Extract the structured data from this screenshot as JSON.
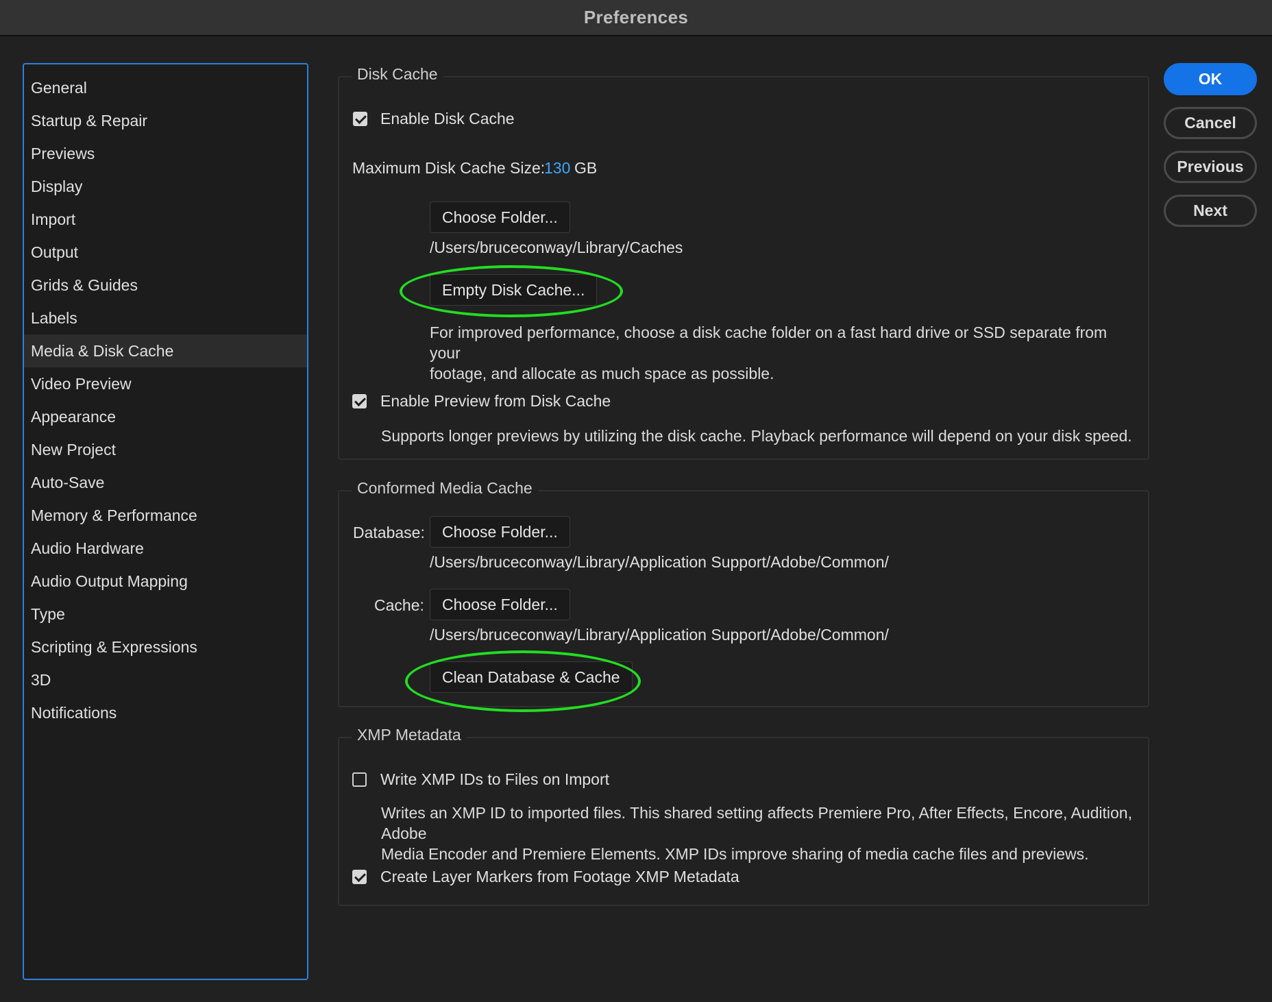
{
  "window": {
    "title": "Preferences"
  },
  "sidebar": {
    "items": [
      {
        "label": "General"
      },
      {
        "label": "Startup & Repair"
      },
      {
        "label": "Previews"
      },
      {
        "label": "Display"
      },
      {
        "label": "Import"
      },
      {
        "label": "Output"
      },
      {
        "label": "Grids & Guides"
      },
      {
        "label": "Labels"
      },
      {
        "label": "Media & Disk Cache",
        "selected": true
      },
      {
        "label": "Video Preview"
      },
      {
        "label": "Appearance"
      },
      {
        "label": "New Project"
      },
      {
        "label": "Auto-Save"
      },
      {
        "label": "Memory & Performance"
      },
      {
        "label": "Audio Hardware"
      },
      {
        "label": "Audio Output Mapping"
      },
      {
        "label": "Type"
      },
      {
        "label": "Scripting & Expressions"
      },
      {
        "label": "3D"
      },
      {
        "label": "Notifications"
      }
    ]
  },
  "disk_cache": {
    "legend": "Disk Cache",
    "enable_label": "Enable Disk Cache",
    "enable_checked": true,
    "max_size_label": "Maximum Disk Cache Size:",
    "max_size_value": "130",
    "max_size_unit": "GB",
    "choose_folder_label": "Choose Folder...",
    "folder_path": "/Users/bruceconway/Library/Caches",
    "empty_cache_label": "Empty Disk Cache...",
    "tip_line1": "For improved performance, choose a disk cache folder on a fast hard drive or SSD separate from your",
    "tip_line2": "footage, and allocate as much space as possible.",
    "preview_label": "Enable Preview from Disk Cache",
    "preview_checked": true,
    "preview_desc": "Supports longer previews by utilizing the disk cache. Playback performance will depend on your disk speed."
  },
  "conformed_cache": {
    "legend": "Conformed Media Cache",
    "database_label": "Database:",
    "database_button": "Choose Folder...",
    "database_path": "/Users/bruceconway/Library/Application Support/Adobe/Common/",
    "cache_label": "Cache:",
    "cache_button": "Choose Folder...",
    "cache_path": "/Users/bruceconway/Library/Application Support/Adobe/Common/",
    "clean_label": "Clean Database & Cache"
  },
  "xmp": {
    "legend": "XMP Metadata",
    "write_label": "Write XMP IDs to Files on Import",
    "write_checked": false,
    "write_desc_line1": "Writes an XMP ID to imported files. This shared setting affects Premiere Pro, After Effects, Encore, Audition, Adobe",
    "write_desc_line2": "Media Encoder and Premiere Elements. XMP IDs improve sharing of media cache files and previews.",
    "markers_label": "Create Layer Markers from Footage XMP Metadata",
    "markers_checked": true
  },
  "dialog_buttons": {
    "ok": "OK",
    "cancel": "Cancel",
    "previous": "Previous",
    "next": "Next"
  },
  "colors": {
    "accent": "#1473e6",
    "sidebar_border": "#2f7fd8",
    "highlight": "#22dd22",
    "value_link": "#3ea6ff"
  }
}
